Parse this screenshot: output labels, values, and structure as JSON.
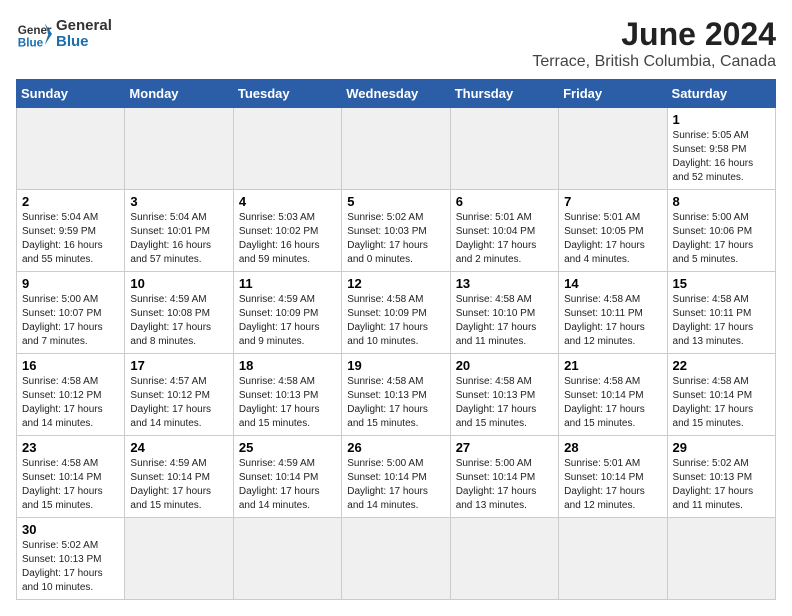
{
  "header": {
    "logo_general": "General",
    "logo_blue": "Blue",
    "title": "June 2024",
    "subtitle": "Terrace, British Columbia, Canada"
  },
  "weekdays": [
    "Sunday",
    "Monday",
    "Tuesday",
    "Wednesday",
    "Thursday",
    "Friday",
    "Saturday"
  ],
  "weeks": [
    [
      {
        "day": "",
        "text": ""
      },
      {
        "day": "",
        "text": ""
      },
      {
        "day": "",
        "text": ""
      },
      {
        "day": "",
        "text": ""
      },
      {
        "day": "",
        "text": ""
      },
      {
        "day": "",
        "text": ""
      },
      {
        "day": "1",
        "text": "Sunrise: 5:05 AM\nSunset: 9:58 PM\nDaylight: 16 hours\nand 52 minutes."
      }
    ],
    [
      {
        "day": "2",
        "text": "Sunrise: 5:04 AM\nSunset: 9:59 PM\nDaylight: 16 hours\nand 55 minutes."
      },
      {
        "day": "3",
        "text": "Sunrise: 5:04 AM\nSunset: 10:01 PM\nDaylight: 16 hours\nand 57 minutes."
      },
      {
        "day": "4",
        "text": "Sunrise: 5:03 AM\nSunset: 10:02 PM\nDaylight: 16 hours\nand 59 minutes."
      },
      {
        "day": "5",
        "text": "Sunrise: 5:02 AM\nSunset: 10:03 PM\nDaylight: 17 hours\nand 0 minutes."
      },
      {
        "day": "6",
        "text": "Sunrise: 5:01 AM\nSunset: 10:04 PM\nDaylight: 17 hours\nand 2 minutes."
      },
      {
        "day": "7",
        "text": "Sunrise: 5:01 AM\nSunset: 10:05 PM\nDaylight: 17 hours\nand 4 minutes."
      },
      {
        "day": "8",
        "text": "Sunrise: 5:00 AM\nSunset: 10:06 PM\nDaylight: 17 hours\nand 5 minutes."
      }
    ],
    [
      {
        "day": "9",
        "text": "Sunrise: 5:00 AM\nSunset: 10:07 PM\nDaylight: 17 hours\nand 7 minutes."
      },
      {
        "day": "10",
        "text": "Sunrise: 4:59 AM\nSunset: 10:08 PM\nDaylight: 17 hours\nand 8 minutes."
      },
      {
        "day": "11",
        "text": "Sunrise: 4:59 AM\nSunset: 10:09 PM\nDaylight: 17 hours\nand 9 minutes."
      },
      {
        "day": "12",
        "text": "Sunrise: 4:58 AM\nSunset: 10:09 PM\nDaylight: 17 hours\nand 10 minutes."
      },
      {
        "day": "13",
        "text": "Sunrise: 4:58 AM\nSunset: 10:10 PM\nDaylight: 17 hours\nand 11 minutes."
      },
      {
        "day": "14",
        "text": "Sunrise: 4:58 AM\nSunset: 10:11 PM\nDaylight: 17 hours\nand 12 minutes."
      },
      {
        "day": "15",
        "text": "Sunrise: 4:58 AM\nSunset: 10:11 PM\nDaylight: 17 hours\nand 13 minutes."
      }
    ],
    [
      {
        "day": "16",
        "text": "Sunrise: 4:58 AM\nSunset: 10:12 PM\nDaylight: 17 hours\nand 14 minutes."
      },
      {
        "day": "17",
        "text": "Sunrise: 4:57 AM\nSunset: 10:12 PM\nDaylight: 17 hours\nand 14 minutes."
      },
      {
        "day": "18",
        "text": "Sunrise: 4:58 AM\nSunset: 10:13 PM\nDaylight: 17 hours\nand 15 minutes."
      },
      {
        "day": "19",
        "text": "Sunrise: 4:58 AM\nSunset: 10:13 PM\nDaylight: 17 hours\nand 15 minutes."
      },
      {
        "day": "20",
        "text": "Sunrise: 4:58 AM\nSunset: 10:13 PM\nDaylight: 17 hours\nand 15 minutes."
      },
      {
        "day": "21",
        "text": "Sunrise: 4:58 AM\nSunset: 10:14 PM\nDaylight: 17 hours\nand 15 minutes."
      },
      {
        "day": "22",
        "text": "Sunrise: 4:58 AM\nSunset: 10:14 PM\nDaylight: 17 hours\nand 15 minutes."
      }
    ],
    [
      {
        "day": "23",
        "text": "Sunrise: 4:58 AM\nSunset: 10:14 PM\nDaylight: 17 hours\nand 15 minutes."
      },
      {
        "day": "24",
        "text": "Sunrise: 4:59 AM\nSunset: 10:14 PM\nDaylight: 17 hours\nand 15 minutes."
      },
      {
        "day": "25",
        "text": "Sunrise: 4:59 AM\nSunset: 10:14 PM\nDaylight: 17 hours\nand 14 minutes."
      },
      {
        "day": "26",
        "text": "Sunrise: 5:00 AM\nSunset: 10:14 PM\nDaylight: 17 hours\nand 14 minutes."
      },
      {
        "day": "27",
        "text": "Sunrise: 5:00 AM\nSunset: 10:14 PM\nDaylight: 17 hours\nand 13 minutes."
      },
      {
        "day": "28",
        "text": "Sunrise: 5:01 AM\nSunset: 10:14 PM\nDaylight: 17 hours\nand 12 minutes."
      },
      {
        "day": "29",
        "text": "Sunrise: 5:02 AM\nSunset: 10:13 PM\nDaylight: 17 hours\nand 11 minutes."
      }
    ],
    [
      {
        "day": "30",
        "text": "Sunrise: 5:02 AM\nSunset: 10:13 PM\nDaylight: 17 hours\nand 10 minutes."
      },
      {
        "day": "",
        "text": ""
      },
      {
        "day": "",
        "text": ""
      },
      {
        "day": "",
        "text": ""
      },
      {
        "day": "",
        "text": ""
      },
      {
        "day": "",
        "text": ""
      },
      {
        "day": "",
        "text": ""
      }
    ]
  ]
}
